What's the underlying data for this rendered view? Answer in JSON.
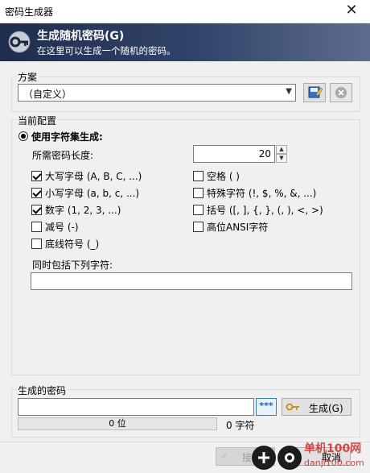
{
  "window": {
    "title": "密码生成器",
    "close_glyph": "✕"
  },
  "banner": {
    "heading": "生成随机密码(G)",
    "subtitle": "在这里可以生成一个随机的密码。",
    "icon": "key-icon"
  },
  "profile": {
    "group_label": "方案",
    "selected": "（自定义）",
    "save_icon": "save-profile-icon",
    "delete_icon": "delete-profile-icon"
  },
  "config": {
    "group_label": "当前配置",
    "mode_label": "使用字符集生成:",
    "length_label": "所需密码长度:",
    "length_value": "20",
    "left_options": [
      {
        "label": "大写字母 (A, B, C, ...)",
        "checked": true
      },
      {
        "label": "小写字母 (a, b, c, ...)",
        "checked": true
      },
      {
        "label": "数字 (1, 2, 3, ...)",
        "checked": true
      },
      {
        "label": "减号 (-)",
        "checked": false
      },
      {
        "label": "底线符号 (_)",
        "checked": false
      }
    ],
    "right_options": [
      {
        "label": "空格 ( )",
        "checked": false
      },
      {
        "label": "特殊字符 (!, $, %, &, ...)",
        "checked": false
      },
      {
        "label": "括号 ([, ], {, }, (, ), <, >)",
        "checked": false
      },
      {
        "label": "高位ANSI字符",
        "checked": false
      }
    ],
    "include_label": "同时包括下列字符:",
    "include_value": ""
  },
  "generated": {
    "group_label": "生成的密码",
    "password_value": "",
    "toggle_label": "***",
    "generate_label": "生成(G)",
    "strength_text": "0 位",
    "strength_fraction": 0,
    "char_count": "0 字符"
  },
  "footer": {
    "accept_label": "接受",
    "cancel_label": "取消"
  },
  "watermark": {
    "line1": "单机100网",
    "line2": "danji100.com"
  }
}
